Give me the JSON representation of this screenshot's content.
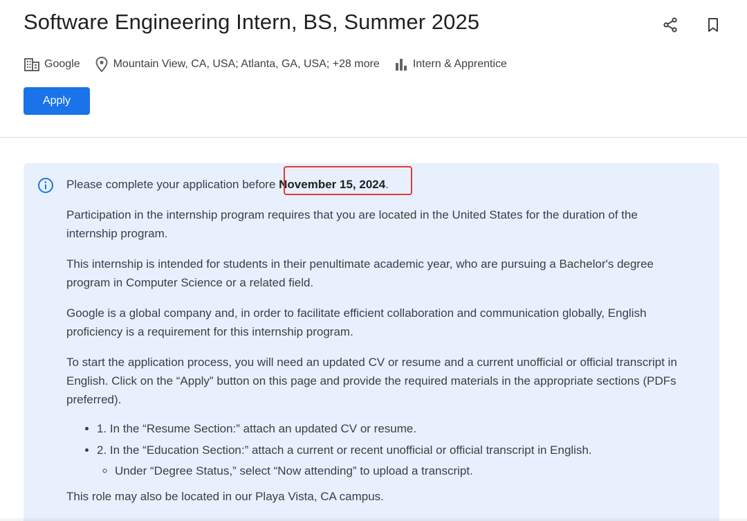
{
  "job": {
    "title": "Software Engineering Intern, BS, Summer 2025",
    "company": "Google",
    "locations": "Mountain View, CA, USA; Atlanta, GA, USA; +28 more",
    "level": "Intern & Apprentice",
    "apply_label": "Apply"
  },
  "icons": {
    "company": "building-icon",
    "location": "location-pin-icon",
    "level": "bar-chart-icon",
    "share": "share-icon",
    "bookmark": "bookmark-icon",
    "info": "info-icon"
  },
  "colors": {
    "accent": "#1a73e8",
    "panel_bg": "#e8f0fe",
    "highlight": "#e53935"
  },
  "info": {
    "deadline_prefix": "Please complete your application before ",
    "deadline_date": "November 15, 2024",
    "deadline_suffix": ".",
    "paragraphs": [
      "Participation in the internship program requires that you are located in the United States for the duration of the internship program.",
      "This internship is intended for students in their penultimate academic year, who are pursuing a Bachelor's degree program in Computer Science or a related field.",
      "Google is a global company and, in order to facilitate efficient collaboration and communication globally, English proficiency is a requirement for this internship program.",
      "To start the application process, you will need an updated CV or resume and a current unofficial or official transcript in English. Click on the “Apply” button on this page and provide the required materials in the appropriate sections (PDFs preferred)."
    ],
    "steps": [
      "1. In the “Resume Section:” attach an updated CV or resume.",
      "2. In the “Education Section:” attach a current or recent unofficial or official transcript in English."
    ],
    "sub_step": "Under “Degree Status,” select “Now attending” to upload a transcript.",
    "closing": "This role may also be located in our Playa Vista, CA campus."
  }
}
